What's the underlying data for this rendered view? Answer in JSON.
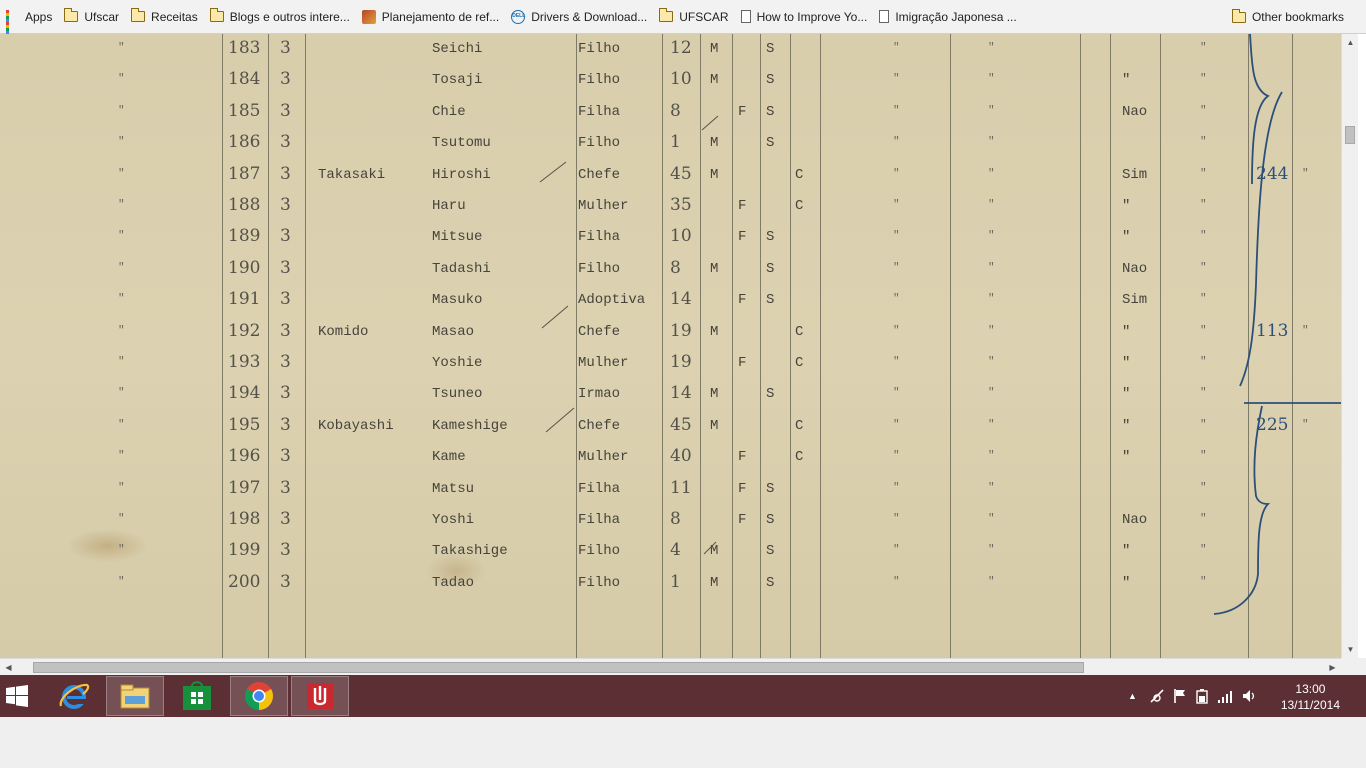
{
  "bookmarks": {
    "items": [
      {
        "label": "Apps",
        "icon": "apps-grid-icon"
      },
      {
        "label": "Ufscar",
        "icon": "folder-icon"
      },
      {
        "label": "Receitas",
        "icon": "folder-icon"
      },
      {
        "label": "Blogs e outros intere...",
        "icon": "folder-icon"
      },
      {
        "label": "Planejamento de ref...",
        "icon": "site-favicon"
      },
      {
        "label": "Drivers & Download...",
        "icon": "dell-icon"
      },
      {
        "label": "UFSCAR",
        "icon": "folder-icon"
      },
      {
        "label": "How to Improve Yo...",
        "icon": "page-icon"
      },
      {
        "label": "Imigração Japonesa ...",
        "icon": "page-icon"
      }
    ],
    "other_label": "Other bookmarks"
  },
  "document": {
    "ditto_mark": "\"",
    "rows": [
      {
        "num": "183",
        "col2": "3",
        "surname": "",
        "name": "Seichi",
        "relation": "Filho",
        "age": "12",
        "male": "M",
        "female": "",
        "status": "S",
        "civil": "",
        "flag": "",
        "lot": ""
      },
      {
        "num": "184",
        "col2": "3",
        "surname": "",
        "name": "Tosaji",
        "relation": "Filho",
        "age": "10",
        "male": "M",
        "female": "",
        "status": "S",
        "civil": "",
        "flag": "\"",
        "lot": ""
      },
      {
        "num": "185",
        "col2": "3",
        "surname": "",
        "name": "Chie",
        "relation": "Filha",
        "age": "8",
        "male": "",
        "female": "F",
        "status": "S",
        "civil": "",
        "flag": "Nao",
        "lot": ""
      },
      {
        "num": "186",
        "col2": "3",
        "surname": "",
        "name": "Tsutomu",
        "relation": "Filho",
        "age": "1",
        "male": "M",
        "female": "",
        "status": "S",
        "civil": "",
        "flag": "",
        "lot": ""
      },
      {
        "num": "187",
        "col2": "3",
        "surname": "Takasaki",
        "name": "Hiroshi",
        "relation": "Chefe",
        "age": "45",
        "male": "M",
        "female": "",
        "status": "",
        "civil": "C",
        "flag": "Sim",
        "lot": "244"
      },
      {
        "num": "188",
        "col2": "3",
        "surname": "",
        "name": "Haru",
        "relation": "Mulher",
        "age": "35",
        "male": "",
        "female": "F",
        "status": "",
        "civil": "C",
        "flag": "\"",
        "lot": ""
      },
      {
        "num": "189",
        "col2": "3",
        "surname": "",
        "name": "Mitsue",
        "relation": "Filha",
        "age": "10",
        "male": "",
        "female": "F",
        "status": "S",
        "civil": "",
        "flag": "\"",
        "lot": ""
      },
      {
        "num": "190",
        "col2": "3",
        "surname": "",
        "name": "Tadashi",
        "relation": "Filho",
        "age": "8",
        "male": "M",
        "female": "",
        "status": "S",
        "civil": "",
        "flag": "Nao",
        "lot": ""
      },
      {
        "num": "191",
        "col2": "3",
        "surname": "",
        "name": "Masuko",
        "relation": "Adoptiva",
        "age": "14",
        "male": "",
        "female": "F",
        "status": "S",
        "civil": "",
        "flag": "Sim",
        "lot": ""
      },
      {
        "num": "192",
        "col2": "3",
        "surname": "Komido",
        "name": "Masao",
        "relation": "Chefe",
        "age": "19",
        "male": "M",
        "female": "",
        "status": "",
        "civil": "C",
        "flag": "\"",
        "lot": "113"
      },
      {
        "num": "193",
        "col2": "3",
        "surname": "",
        "name": "Yoshie",
        "relation": "Mulher",
        "age": "19",
        "male": "",
        "female": "F",
        "status": "",
        "civil": "C",
        "flag": "\"",
        "lot": ""
      },
      {
        "num": "194",
        "col2": "3",
        "surname": "",
        "name": "Tsuneo",
        "relation": "Irmao",
        "age": "14",
        "male": "M",
        "female": "",
        "status": "S",
        "civil": "",
        "flag": "\"",
        "lot": ""
      },
      {
        "num": "195",
        "col2": "3",
        "surname": "Kobayashi",
        "name": "Kameshige",
        "relation": "Chefe",
        "age": "45",
        "male": "M",
        "female": "",
        "status": "",
        "civil": "C",
        "flag": "\"",
        "lot": "225"
      },
      {
        "num": "196",
        "col2": "3",
        "surname": "",
        "name": "Kame",
        "relation": "Mulher",
        "age": "40",
        "male": "",
        "female": "F",
        "status": "",
        "civil": "C",
        "flag": "\"",
        "lot": ""
      },
      {
        "num": "197",
        "col2": "3",
        "surname": "",
        "name": "Matsu",
        "relation": "Filha",
        "age": "11",
        "male": "",
        "female": "F",
        "status": "S",
        "civil": "",
        "flag": "",
        "lot": ""
      },
      {
        "num": "198",
        "col2": "3",
        "surname": "",
        "name": "Yoshi",
        "relation": "Filha",
        "age": "8",
        "male": "",
        "female": "F",
        "status": "S",
        "civil": "",
        "flag": "Nao",
        "lot": ""
      },
      {
        "num": "199",
        "col2": "3",
        "surname": "",
        "name": "Takashige",
        "relation": "Filho",
        "age": "4",
        "male": "M",
        "female": "",
        "status": "S",
        "civil": "",
        "flag": "\"",
        "lot": ""
      },
      {
        "num": "200",
        "col2": "3",
        "surname": "",
        "name": "Tadao",
        "relation": "Filho",
        "age": "1",
        "male": "M",
        "female": "",
        "status": "S",
        "civil": "",
        "flag": "\"",
        "lot": ""
      }
    ]
  },
  "taskbar": {
    "apps": [
      {
        "name": "start-button",
        "icon": "windows-logo-icon"
      },
      {
        "name": "internet-explorer",
        "icon": "internet-explorer-icon"
      },
      {
        "name": "file-explorer",
        "icon": "folder-icon"
      },
      {
        "name": "windows-store",
        "icon": "store-icon"
      },
      {
        "name": "chrome",
        "icon": "chrome-icon",
        "active": true
      },
      {
        "name": "pdf-viewer",
        "icon": "pdf-icon"
      }
    ],
    "tray_icons": [
      "chevron-up-icon",
      "network-icon",
      "flag-icon",
      "battery-icon",
      "signal-bars-icon",
      "speaker-icon"
    ],
    "time": "13:00",
    "date": "13/11/2014"
  },
  "colors": {
    "paper": "#d8ceac",
    "ink": "#46433b",
    "blue_ink": "#2b4f7a",
    "taskbar": "#5b2f34",
    "bookmarks_bar": "#f2f2f2"
  }
}
